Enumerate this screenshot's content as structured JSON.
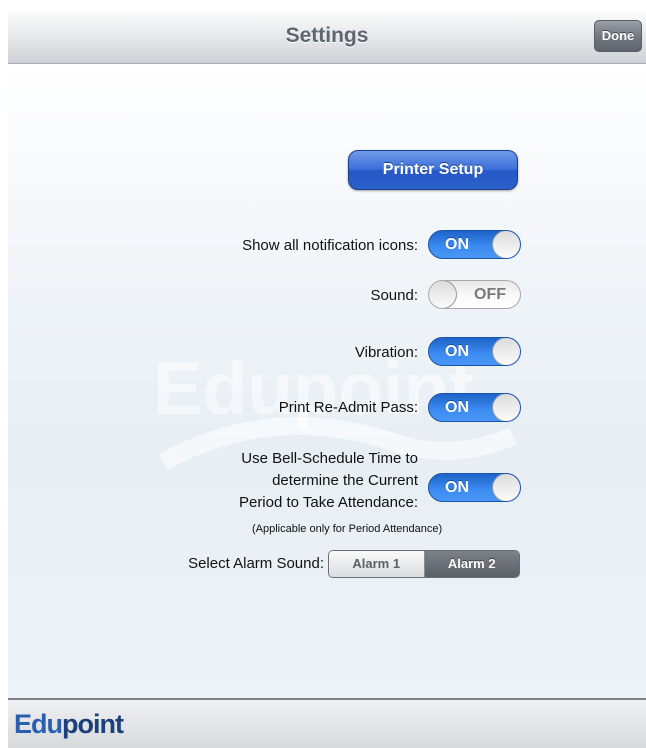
{
  "navbar": {
    "title": "Settings",
    "done_label": "Done"
  },
  "printer_button": "Printer Setup",
  "settings": [
    {
      "label": "Show all notification icons:",
      "state": "ON"
    },
    {
      "label": "Sound:",
      "state": "OFF"
    },
    {
      "label": "Vibration:",
      "state": "ON"
    },
    {
      "label": "Print Re-Admit Pass:",
      "state": "ON"
    },
    {
      "label_lines": [
        "Use Bell-Schedule Time to",
        "determine the Current",
        "Period to Take Attendance:"
      ],
      "state": "ON"
    }
  ],
  "note": "(Applicable only for Period Attendance)",
  "alarm": {
    "label": "Select Alarm Sound:",
    "options": [
      "Alarm 1",
      "Alarm 2"
    ],
    "selected": "Alarm 2"
  },
  "footer": {
    "logo_part1": "Edu",
    "logo_part2": "point"
  },
  "watermark_text": "Edupoint",
  "colors": {
    "toggle_on": "#2f7ae5",
    "primary_button": "#2b5fc9",
    "segment_selected": "#5b5f66"
  }
}
